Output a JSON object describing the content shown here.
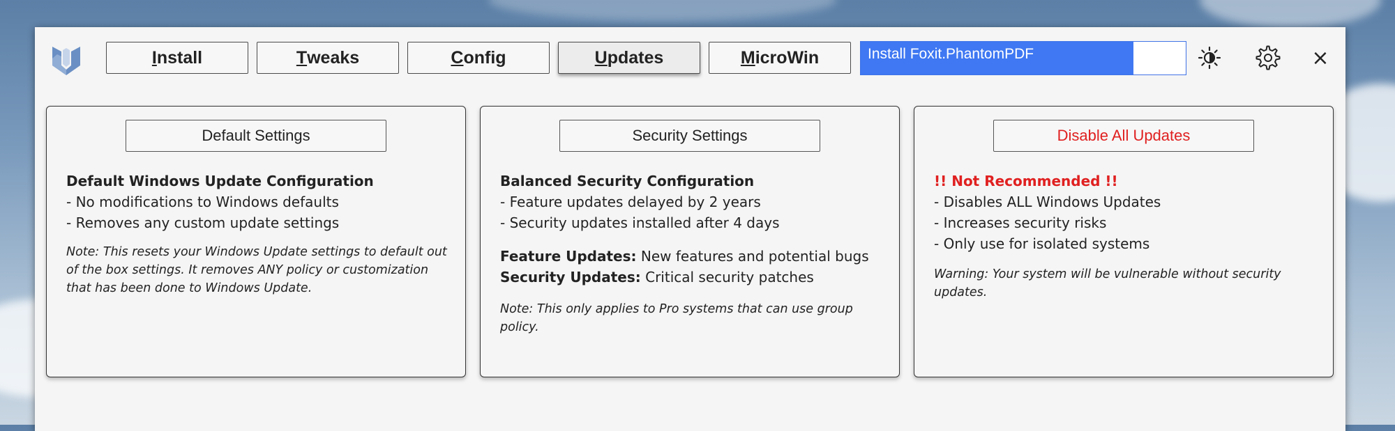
{
  "nav": {
    "tabs": [
      {
        "mnemonic": "I",
        "rest": "nstall"
      },
      {
        "mnemonic": "T",
        "rest": "weaks"
      },
      {
        "mnemonic": "C",
        "rest": "onfig"
      },
      {
        "mnemonic": "U",
        "rest": "pdates"
      },
      {
        "mnemonic": "M",
        "rest": "icroWin"
      }
    ],
    "active_tab": "Updates"
  },
  "status": {
    "text": "Install Foxit.PhantomPDF",
    "progress": 0.84
  },
  "toolbar": {
    "theme_icon": "theme-toggle-icon",
    "settings_icon": "gear-icon",
    "close_label": "×"
  },
  "cards": [
    {
      "button": "Default Settings",
      "heading": "Default Windows Update Configuration",
      "lines": [
        "- No modifications to Windows defaults",
        "- Removes any custom update settings"
      ],
      "note": "Note: This resets your Windows Update settings to default out of the box settings. It removes ANY policy or customization that has been done to Windows Update."
    },
    {
      "button": "Security Settings",
      "heading": "Balanced Security Configuration",
      "lines": [
        "- Feature updates delayed by 2 years",
        "- Security updates installed after 4 days"
      ],
      "feature_label": "Feature Updates:",
      "feature_text": " New features and potential bugs",
      "security_label": "Security Updates:",
      "security_text": " Critical security patches",
      "note": "Note: This only applies to Pro systems that can use group policy."
    },
    {
      "button": "Disable All Updates",
      "heading": "!! Not Recommended !!",
      "lines": [
        "- Disables ALL Windows Updates",
        "- Increases security risks",
        "- Only use for isolated systems"
      ],
      "note": "Warning: Your system will be vulnerable without security updates."
    }
  ],
  "colors": {
    "accent": "#3f78f2",
    "danger": "#e02020"
  }
}
